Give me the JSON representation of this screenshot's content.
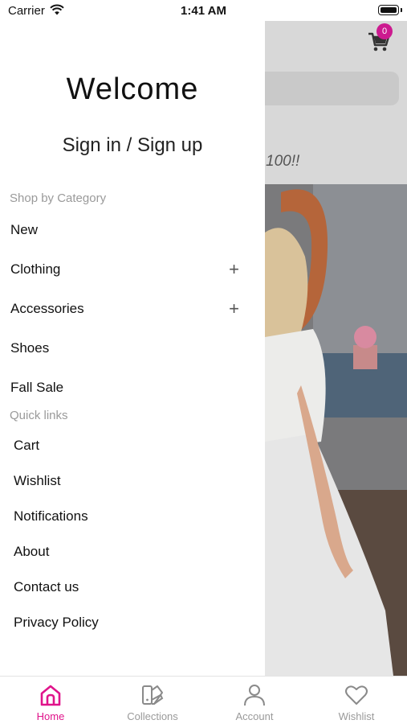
{
  "status_bar": {
    "carrier": "Carrier",
    "time": "1:41 AM"
  },
  "background": {
    "cart_badge": "0",
    "promo_text": "100!!"
  },
  "drawer": {
    "welcome": "Welcome",
    "signin": "Sign in / Sign up",
    "shop_by_category_title": "Shop by Category",
    "categories": [
      {
        "label": "New",
        "expandable": false
      },
      {
        "label": "Clothing",
        "expandable": true
      },
      {
        "label": "Accessories",
        "expandable": true
      },
      {
        "label": "Shoes",
        "expandable": false
      },
      {
        "label": "Fall Sale",
        "expandable": false
      }
    ],
    "quick_links_title": "Quick links",
    "quick_links": [
      "Cart",
      "Wishlist",
      "Notifications",
      "About",
      "Contact us",
      "Privacy Policy"
    ]
  },
  "tab_bar": {
    "tabs": [
      {
        "label": "Home",
        "icon": "home-icon",
        "active": true
      },
      {
        "label": "Collections",
        "icon": "collections-icon",
        "active": false
      },
      {
        "label": "Account",
        "icon": "account-icon",
        "active": false
      },
      {
        "label": "Wishlist",
        "icon": "heart-icon",
        "active": false
      }
    ]
  },
  "colors": {
    "accent": "#e0148b",
    "badge": "#cc1a8f",
    "muted": "#9a9a9a"
  }
}
